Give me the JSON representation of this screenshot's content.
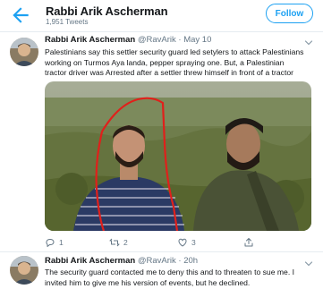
{
  "header": {
    "name": "Rabbi Arik Ascherman",
    "tweet_count": "1,951 Tweets",
    "follow_label": "Follow",
    "back_icon": "back-arrow-icon"
  },
  "tweets": [
    {
      "name": "Rabbi Arik Ascherman",
      "handle": "@RavArik",
      "separator": "·",
      "time": "May 10",
      "lines": [
        "Palestinians say this settler security guard led setylers to attack Palestinians",
        "working on Turmos Aya landa, pepper spraying one. But, a Palestinian",
        "tractor driver was Arrested after a settler threw himself in front of a tractor"
      ],
      "replies": "1",
      "retweets": "2",
      "likes": "3"
    },
    {
      "name": "Rabbi Arik Ascherman",
      "handle": "@RavArik",
      "separator": "·",
      "time": "20h",
      "lines": [
        "The security guard contacted me to deny this and to threaten to sue me.  I",
        "invited him to give me his version of events, but he declined."
      ]
    }
  ],
  "colors": {
    "accent": "#1da1f2",
    "text": "#14171a",
    "muted": "#657786",
    "divider": "#e6ecf0",
    "annotation": "#e0201b"
  }
}
